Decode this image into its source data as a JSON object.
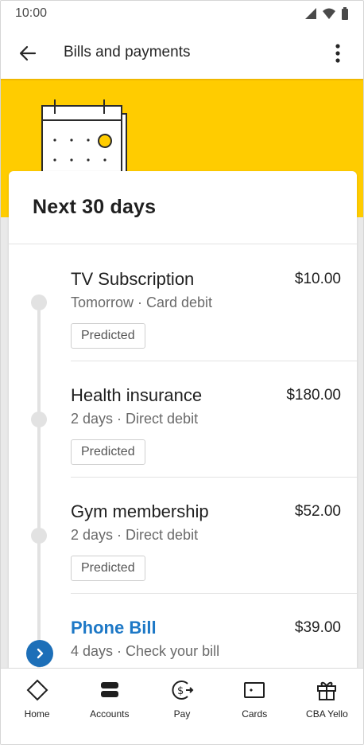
{
  "status_bar": {
    "time": "10:00"
  },
  "app_bar": {
    "title": "Bills and payments"
  },
  "card": {
    "title": "Next 30 days"
  },
  "bills": [
    {
      "name": "TV Subscription",
      "amount": "$10.00",
      "detail": "Tomorrow · Card debit",
      "chip": "Predicted"
    },
    {
      "name": "Health insurance",
      "amount": "$180.00",
      "detail": "2 days · Direct debit",
      "chip": "Predicted"
    },
    {
      "name": "Gym membership",
      "amount": "$52.00",
      "detail": "2 days · Direct debit",
      "chip": "Predicted"
    },
    {
      "name": "Phone Bill",
      "amount": "$39.00",
      "detail": "4 days · Check your bill"
    }
  ],
  "bottom_nav": [
    {
      "label": "Home",
      "icon": "home-diamond-icon"
    },
    {
      "label": "Accounts",
      "icon": "accounts-icon"
    },
    {
      "label": "Pay",
      "icon": "pay-icon"
    },
    {
      "label": "Cards",
      "icon": "card-icon"
    },
    {
      "label": "CBA Yello",
      "icon": "gift-icon"
    }
  ],
  "colors": {
    "banner": "#ffcc00",
    "link": "#1d78c6",
    "accent_button": "#1d6fb8"
  }
}
